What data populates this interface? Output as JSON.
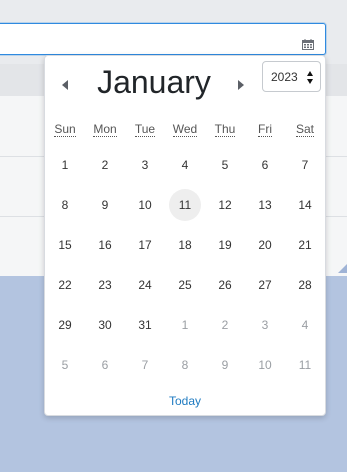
{
  "datepicker": {
    "month": "January",
    "year": "2023",
    "weekdays": [
      "Sun",
      "Mon",
      "Tue",
      "Wed",
      "Thu",
      "Fri",
      "Sat"
    ],
    "weeks": [
      [
        {
          "d": "1",
          "m": "cur"
        },
        {
          "d": "2",
          "m": "cur"
        },
        {
          "d": "3",
          "m": "cur"
        },
        {
          "d": "4",
          "m": "cur"
        },
        {
          "d": "5",
          "m": "cur"
        },
        {
          "d": "6",
          "m": "cur"
        },
        {
          "d": "7",
          "m": "cur"
        }
      ],
      [
        {
          "d": "8",
          "m": "cur"
        },
        {
          "d": "9",
          "m": "cur"
        },
        {
          "d": "10",
          "m": "cur"
        },
        {
          "d": "11",
          "m": "cur",
          "today": true
        },
        {
          "d": "12",
          "m": "cur"
        },
        {
          "d": "13",
          "m": "cur"
        },
        {
          "d": "14",
          "m": "cur"
        }
      ],
      [
        {
          "d": "15",
          "m": "cur"
        },
        {
          "d": "16",
          "m": "cur"
        },
        {
          "d": "17",
          "m": "cur"
        },
        {
          "d": "18",
          "m": "cur"
        },
        {
          "d": "19",
          "m": "cur"
        },
        {
          "d": "20",
          "m": "cur"
        },
        {
          "d": "21",
          "m": "cur"
        }
      ],
      [
        {
          "d": "22",
          "m": "cur"
        },
        {
          "d": "23",
          "m": "cur"
        },
        {
          "d": "24",
          "m": "cur"
        },
        {
          "d": "25",
          "m": "cur"
        },
        {
          "d": "26",
          "m": "cur"
        },
        {
          "d": "27",
          "m": "cur"
        },
        {
          "d": "28",
          "m": "cur"
        }
      ],
      [
        {
          "d": "29",
          "m": "cur"
        },
        {
          "d": "30",
          "m": "cur"
        },
        {
          "d": "31",
          "m": "cur"
        },
        {
          "d": "1",
          "m": "next"
        },
        {
          "d": "2",
          "m": "next"
        },
        {
          "d": "3",
          "m": "next"
        },
        {
          "d": "4",
          "m": "next"
        }
      ],
      [
        {
          "d": "5",
          "m": "next"
        },
        {
          "d": "6",
          "m": "next"
        },
        {
          "d": "7",
          "m": "next"
        },
        {
          "d": "8",
          "m": "next"
        },
        {
          "d": "9",
          "m": "next"
        },
        {
          "d": "10",
          "m": "next"
        },
        {
          "d": "11",
          "m": "next"
        }
      ]
    ],
    "today_label": "Today"
  },
  "icons": {
    "calendar": "calendar-icon",
    "prev": "chevron-left-icon",
    "next": "chevron-right-icon",
    "spin_up": "spin-up-icon",
    "spin_down": "spin-down-icon"
  },
  "colors": {
    "accent": "#2f8ae0",
    "link": "#1f7bc1",
    "today_bg": "#eeeeee",
    "other_month_text": "#9a9ea3",
    "page_bg": "#b3c4e0"
  }
}
